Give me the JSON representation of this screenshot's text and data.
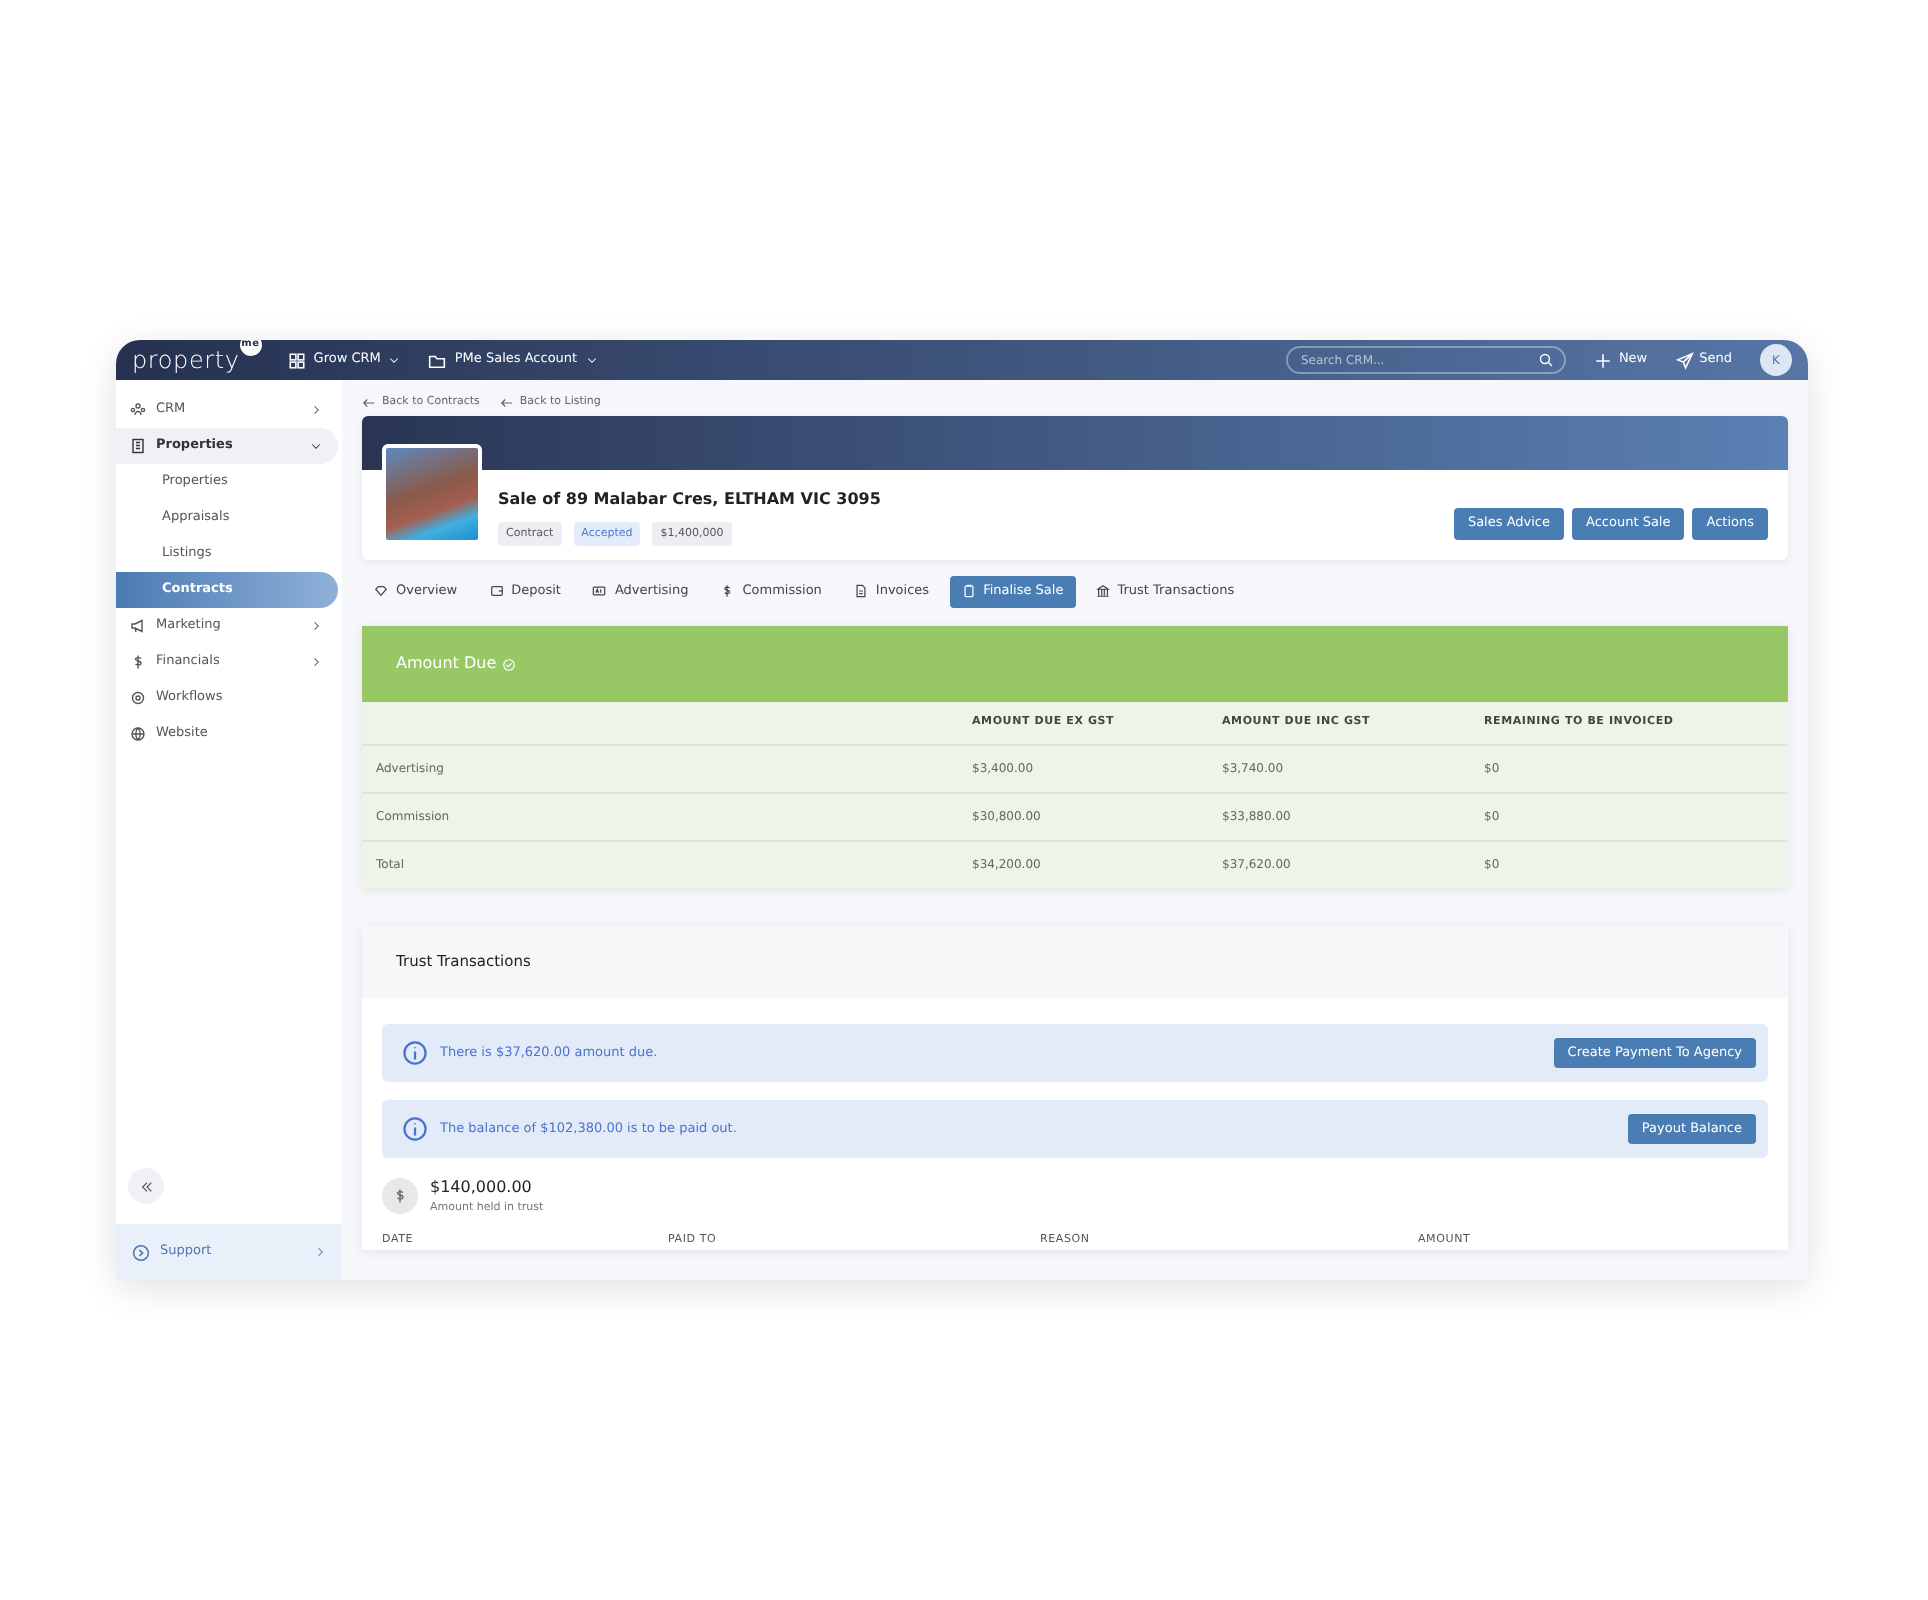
{
  "topbar": {
    "logo": "property",
    "logo_badge": "me",
    "menus": [
      "Grow CRM",
      "PMe Sales Account"
    ],
    "search": {
      "placeholder": "Search CRM..."
    },
    "actions": [
      "New",
      "Send"
    ],
    "avatar": "K"
  },
  "sidebar": {
    "items": [
      {
        "label": "CRM",
        "expanded": false,
        "has_children": true,
        "selected": false
      },
      {
        "label": "Properties",
        "expanded": true,
        "has_children": true,
        "selected": false,
        "children": [
          {
            "label": "Properties",
            "selected": false
          },
          {
            "label": "Appraisals",
            "selected": false
          },
          {
            "label": "Listings",
            "selected": false
          },
          {
            "label": "Contracts",
            "selected": true
          }
        ]
      },
      {
        "label": "Marketing",
        "expanded": false,
        "has_children": true,
        "selected": false
      },
      {
        "label": "Financials",
        "expanded": false,
        "has_children": true,
        "selected": false
      },
      {
        "label": "Workflows",
        "expanded": false,
        "has_children": false,
        "selected": false
      },
      {
        "label": "Website",
        "expanded": false,
        "has_children": false,
        "selected": false
      }
    ],
    "support": "Support"
  },
  "breadcrumbs": [
    "Back to Contracts",
    "Back to Listing"
  ],
  "listing": {
    "title": "Sale of 89 Malabar Cres, ELTHAM VIC 3095",
    "tags": [
      {
        "label": "Contract",
        "kind": "plain"
      },
      {
        "label": "Accepted",
        "kind": "status"
      },
      {
        "label": "$1,400,000",
        "kind": "plain"
      }
    ],
    "buttons": [
      "Sales Advice",
      "Account Sale",
      "Actions"
    ]
  },
  "tabs": [
    {
      "label": "Overview",
      "selected": false
    },
    {
      "label": "Deposit",
      "selected": false
    },
    {
      "label": "Advertising",
      "selected": false
    },
    {
      "label": "Commission",
      "selected": false
    },
    {
      "label": "Invoices",
      "selected": false
    },
    {
      "label": "Finalise Sale",
      "selected": true
    },
    {
      "label": "Trust Transactions",
      "selected": false
    }
  ],
  "amount_due": {
    "title": "Amount Due",
    "columns": [
      "",
      "AMOUNT DUE EX GST",
      "AMOUNT DUE INC GST",
      "REMAINING TO BE INVOICED"
    ],
    "rows": [
      [
        "Advertising",
        "$3,400.00",
        "$3,740.00",
        "$0"
      ],
      [
        "Commission",
        "$30,800.00",
        "$33,880.00",
        "$0"
      ],
      [
        "Total",
        "$34,200.00",
        "$37,620.00",
        "$0"
      ]
    ]
  },
  "trust": {
    "title": "Trust Transactions",
    "alerts": [
      {
        "text": "There is $37,620.00 amount due.",
        "button": "Create Payment To Agency"
      },
      {
        "text": "The balance of $102,380.00 is to be paid out.",
        "button": "Payout Balance"
      }
    ],
    "held": {
      "amount": "$140,000.00",
      "label": "Amount held in trust"
    },
    "columns": [
      "DATE",
      "PAID TO",
      "REASON",
      "AMOUNT"
    ]
  }
}
